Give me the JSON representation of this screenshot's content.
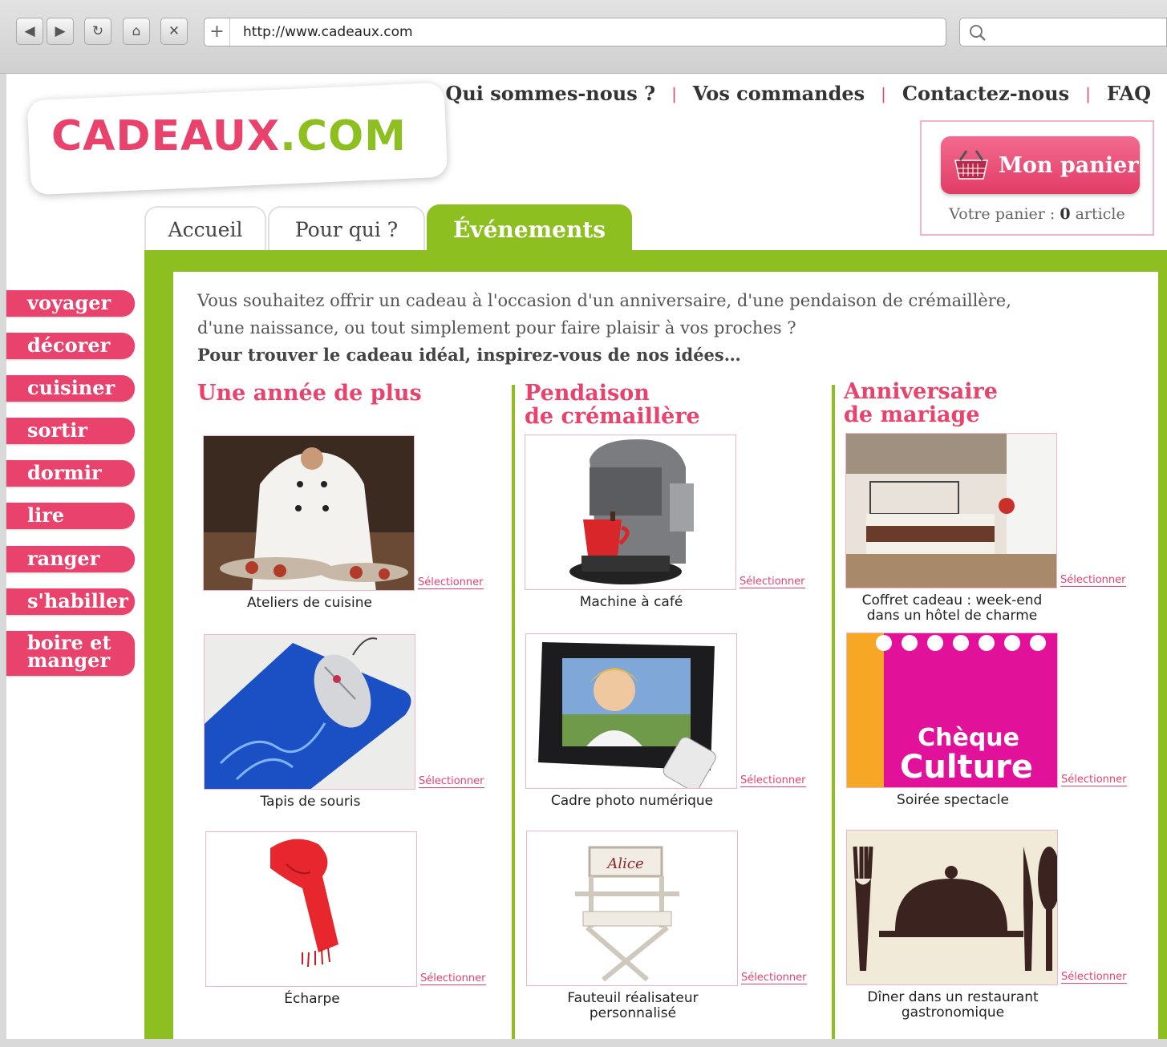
{
  "browser": {
    "url": "http://www.cadeaux.com"
  },
  "logo": {
    "part1": "CADEAUX",
    "part2": ".COM"
  },
  "top_nav": {
    "links": [
      "Qui sommes-nous ?",
      "Vos commandes",
      "Contactez-nous",
      "FAQ"
    ],
    "separator": "|"
  },
  "cart": {
    "button_label": "Mon panier",
    "status_prefix": "Votre panier : ",
    "count": "0",
    "status_suffix": " article"
  },
  "tabs": [
    {
      "label": "Accueil"
    },
    {
      "label": "Pour qui ?"
    },
    {
      "label": "Événements",
      "active": true
    }
  ],
  "sidebar": {
    "items": [
      "voyager",
      "décorer",
      "cuisiner",
      "sortir",
      "dormir",
      "lire",
      "ranger",
      "s'habiller"
    ],
    "last_item": {
      "line1": "boire et",
      "line2": "manger"
    }
  },
  "intro": {
    "line1": "Vous souhaitez offrir un cadeau à l'occasion d'un anniversaire, d'une pendaison de crémaillère,",
    "line2": "d'une naissance, ou tout simplement pour faire plaisir à vos proches ?",
    "line3": "Pour trouver le cadeau idéal, inspirez-vous de nos idées…"
  },
  "select_label": "Sélectionner",
  "columns": [
    {
      "title_line1": "Une année de plus",
      "title_line2": "",
      "products": [
        {
          "caption_line1": "Ateliers de cuisine",
          "caption_line2": ""
        },
        {
          "caption_line1": "Tapis de souris",
          "caption_line2": ""
        },
        {
          "caption_line1": "Écharpe",
          "caption_line2": ""
        }
      ]
    },
    {
      "title_line1": "Pendaison",
      "title_line2": "de crémaillère",
      "products": [
        {
          "caption_line1": "Machine à café",
          "caption_line2": ""
        },
        {
          "caption_line1": "Cadre photo numérique",
          "caption_line2": ""
        },
        {
          "caption_line1": "Fauteuil réalisateur",
          "caption_line2": "personnalisé"
        }
      ]
    },
    {
      "title_line1": "Anniversaire",
      "title_line2": "de mariage",
      "products": [
        {
          "caption_line1": "Coffret cadeau : week-end",
          "caption_line2": "dans un hôtel de charme"
        },
        {
          "caption_line1": "Soirée spectacle",
          "caption_line2": ""
        },
        {
          "caption_line1": "Dîner dans un restaurant",
          "caption_line2": "gastronomique"
        }
      ]
    }
  ],
  "cheque_culture": {
    "line1": "Chèque",
    "line2": "Culture"
  },
  "chair_name": "Alice",
  "colors": {
    "pink": "#e8426d",
    "green": "#8cbf1f"
  }
}
